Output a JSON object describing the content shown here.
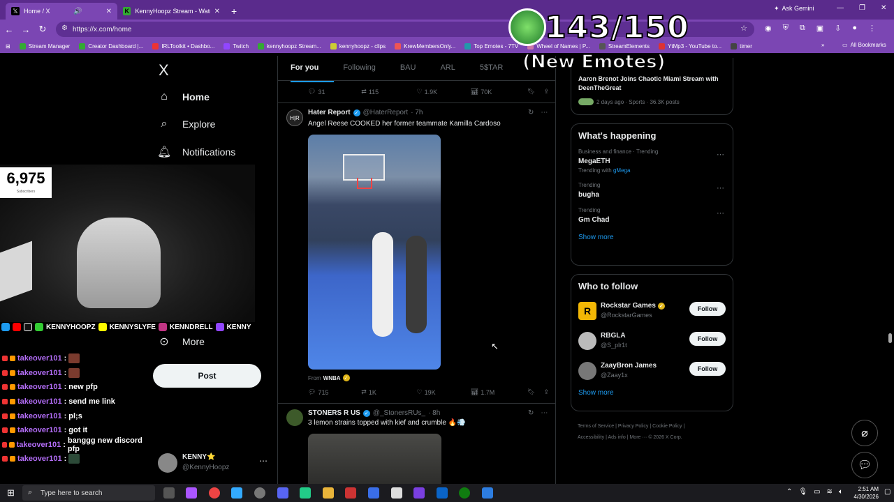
{
  "browser": {
    "tabs": [
      {
        "label": "Home / X",
        "active": true
      },
      {
        "label": "KennyHoopz Stream - Watch Li",
        "active": false
      }
    ],
    "new_tab": "+",
    "ask_gemini": "Ask Gemini",
    "url": "https://x.com/home",
    "bookmarks": [
      "Stream Manager",
      "Creator Dashboard |...",
      "IRLToolkit • Dashbo...",
      "Twitch",
      "kennyhoopz Stream...",
      "kennyhoopz - clips",
      "KrewMembersOnly...",
      "Top Emotes - 7TV",
      "Wheel of Names | P...",
      "StreamElements",
      "YtMp3 - YouTube to...",
      "timer"
    ],
    "all_bookmarks": "All Bookmarks"
  },
  "x_nav": {
    "logo": "X",
    "items": [
      {
        "label": "Home",
        "icon": "home-icon"
      },
      {
        "label": "Explore",
        "icon": "search-icon"
      },
      {
        "label": "Notifications",
        "icon": "bell-icon"
      },
      {
        "label": "More",
        "icon": "more-icon"
      }
    ],
    "post_label": "Post",
    "account_name": "KENNY⭐",
    "account_handle": "@KennyHoopz"
  },
  "feed": {
    "tabs": [
      "For you",
      "Following",
      "BAU",
      "ARL",
      "5$TAR"
    ],
    "top_actions": {
      "replies": "31",
      "reposts": "115",
      "likes": "1.9K",
      "views": "70K"
    },
    "tweet1": {
      "name": "Hater Report",
      "handle": "@HaterReport",
      "time": "· 7h",
      "text": "Angel Reese COOKED her former teammate Kamilla Cardoso",
      "from_label": "From",
      "from_name": "WNBA",
      "actions": {
        "replies": "715",
        "reposts": "1K",
        "likes": "19K",
        "views": "1.7M"
      }
    },
    "tweet2": {
      "name": "STONERS R US",
      "handle": "@_StonersRUs_",
      "time": "· 8h",
      "text": "3 lemon strains topped with kief and crumble 🔥💨"
    }
  },
  "sidebar": {
    "top_snippet": "Aaron Brenot Joins Chaotic Miami Stream with DeenTheGreat",
    "top_meta": "2 days ago · Sports · 36.3K posts",
    "happening_title": "What's happening",
    "trends": [
      {
        "meta": "Business and finance · Trending",
        "name": "MegaETH",
        "sub_prefix": "Trending with",
        "sub_link": "gMega"
      },
      {
        "meta": "Trending",
        "name": "bugha"
      },
      {
        "meta": "Trending",
        "name": "Gm Chad"
      }
    ],
    "show_more": "Show more",
    "who_title": "Who to follow",
    "follow": [
      {
        "name": "Rockstar Games",
        "handle": "@RockstarGames",
        "button": "Follow"
      },
      {
        "name": "RBGLA",
        "handle": "@S_plr1t",
        "button": "Follow"
      },
      {
        "name": "ZaayBron James",
        "handle": "@Zaay1x",
        "button": "Follow"
      }
    ],
    "footer": [
      "Terms of Service",
      "Privacy Policy",
      "Cookie Policy",
      "Accessibility",
      "Ads info",
      "More ···",
      "© 2026 X Corp."
    ]
  },
  "stream": {
    "subs_count": "6,975",
    "subs_label": "Subscribers",
    "socials": [
      "KENNYHOOPZ",
      "KENNYSLYFE",
      "KENNDRELL",
      "KENNY"
    ],
    "emote_count": "143/150",
    "emote_sub": "(New Emotes)",
    "chat": [
      {
        "user": "takeover101",
        "msg": ""
      },
      {
        "user": "takeover101",
        "msg": ""
      },
      {
        "user": "takeover101",
        "msg": "new pfp"
      },
      {
        "user": "takeover101",
        "msg": "send me link"
      },
      {
        "user": "takeover101",
        "msg": "pl;s"
      },
      {
        "user": "takeover101",
        "msg": "got it"
      },
      {
        "user": "takeover101",
        "msg": "banggg new discord pfp"
      },
      {
        "user": "takeover101",
        "msg": ""
      }
    ]
  },
  "taskbar": {
    "search_placeholder": "Type here to search",
    "time": "2:51 AM",
    "date": "4/30/2026"
  },
  "colors": {
    "chrome_purple": "#7b46b3",
    "x_blue": "#1d9bf0",
    "chat_user": "#b36df7"
  }
}
